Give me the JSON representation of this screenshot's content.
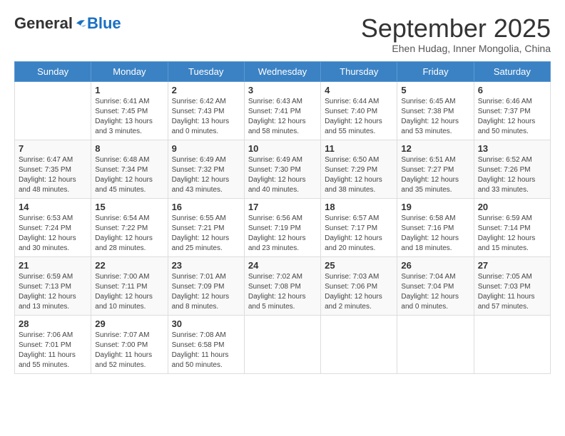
{
  "logo": {
    "general": "General",
    "blue": "Blue"
  },
  "title": {
    "month": "September 2025",
    "location": "Ehen Hudag, Inner Mongolia, China"
  },
  "headers": [
    "Sunday",
    "Monday",
    "Tuesday",
    "Wednesday",
    "Thursday",
    "Friday",
    "Saturday"
  ],
  "weeks": [
    [
      {
        "day": null,
        "sunrise": null,
        "sunset": null,
        "daylight": null
      },
      {
        "day": "1",
        "sunrise": "Sunrise: 6:41 AM",
        "sunset": "Sunset: 7:45 PM",
        "daylight": "Daylight: 13 hours and 3 minutes."
      },
      {
        "day": "2",
        "sunrise": "Sunrise: 6:42 AM",
        "sunset": "Sunset: 7:43 PM",
        "daylight": "Daylight: 13 hours and 0 minutes."
      },
      {
        "day": "3",
        "sunrise": "Sunrise: 6:43 AM",
        "sunset": "Sunset: 7:41 PM",
        "daylight": "Daylight: 12 hours and 58 minutes."
      },
      {
        "day": "4",
        "sunrise": "Sunrise: 6:44 AM",
        "sunset": "Sunset: 7:40 PM",
        "daylight": "Daylight: 12 hours and 55 minutes."
      },
      {
        "day": "5",
        "sunrise": "Sunrise: 6:45 AM",
        "sunset": "Sunset: 7:38 PM",
        "daylight": "Daylight: 12 hours and 53 minutes."
      },
      {
        "day": "6",
        "sunrise": "Sunrise: 6:46 AM",
        "sunset": "Sunset: 7:37 PM",
        "daylight": "Daylight: 12 hours and 50 minutes."
      }
    ],
    [
      {
        "day": "7",
        "sunrise": "Sunrise: 6:47 AM",
        "sunset": "Sunset: 7:35 PM",
        "daylight": "Daylight: 12 hours and 48 minutes."
      },
      {
        "day": "8",
        "sunrise": "Sunrise: 6:48 AM",
        "sunset": "Sunset: 7:34 PM",
        "daylight": "Daylight: 12 hours and 45 minutes."
      },
      {
        "day": "9",
        "sunrise": "Sunrise: 6:49 AM",
        "sunset": "Sunset: 7:32 PM",
        "daylight": "Daylight: 12 hours and 43 minutes."
      },
      {
        "day": "10",
        "sunrise": "Sunrise: 6:49 AM",
        "sunset": "Sunset: 7:30 PM",
        "daylight": "Daylight: 12 hours and 40 minutes."
      },
      {
        "day": "11",
        "sunrise": "Sunrise: 6:50 AM",
        "sunset": "Sunset: 7:29 PM",
        "daylight": "Daylight: 12 hours and 38 minutes."
      },
      {
        "day": "12",
        "sunrise": "Sunrise: 6:51 AM",
        "sunset": "Sunset: 7:27 PM",
        "daylight": "Daylight: 12 hours and 35 minutes."
      },
      {
        "day": "13",
        "sunrise": "Sunrise: 6:52 AM",
        "sunset": "Sunset: 7:26 PM",
        "daylight": "Daylight: 12 hours and 33 minutes."
      }
    ],
    [
      {
        "day": "14",
        "sunrise": "Sunrise: 6:53 AM",
        "sunset": "Sunset: 7:24 PM",
        "daylight": "Daylight: 12 hours and 30 minutes."
      },
      {
        "day": "15",
        "sunrise": "Sunrise: 6:54 AM",
        "sunset": "Sunset: 7:22 PM",
        "daylight": "Daylight: 12 hours and 28 minutes."
      },
      {
        "day": "16",
        "sunrise": "Sunrise: 6:55 AM",
        "sunset": "Sunset: 7:21 PM",
        "daylight": "Daylight: 12 hours and 25 minutes."
      },
      {
        "day": "17",
        "sunrise": "Sunrise: 6:56 AM",
        "sunset": "Sunset: 7:19 PM",
        "daylight": "Daylight: 12 hours and 23 minutes."
      },
      {
        "day": "18",
        "sunrise": "Sunrise: 6:57 AM",
        "sunset": "Sunset: 7:17 PM",
        "daylight": "Daylight: 12 hours and 20 minutes."
      },
      {
        "day": "19",
        "sunrise": "Sunrise: 6:58 AM",
        "sunset": "Sunset: 7:16 PM",
        "daylight": "Daylight: 12 hours and 18 minutes."
      },
      {
        "day": "20",
        "sunrise": "Sunrise: 6:59 AM",
        "sunset": "Sunset: 7:14 PM",
        "daylight": "Daylight: 12 hours and 15 minutes."
      }
    ],
    [
      {
        "day": "21",
        "sunrise": "Sunrise: 6:59 AM",
        "sunset": "Sunset: 7:13 PM",
        "daylight": "Daylight: 12 hours and 13 minutes."
      },
      {
        "day": "22",
        "sunrise": "Sunrise: 7:00 AM",
        "sunset": "Sunset: 7:11 PM",
        "daylight": "Daylight: 12 hours and 10 minutes."
      },
      {
        "day": "23",
        "sunrise": "Sunrise: 7:01 AM",
        "sunset": "Sunset: 7:09 PM",
        "daylight": "Daylight: 12 hours and 8 minutes."
      },
      {
        "day": "24",
        "sunrise": "Sunrise: 7:02 AM",
        "sunset": "Sunset: 7:08 PM",
        "daylight": "Daylight: 12 hours and 5 minutes."
      },
      {
        "day": "25",
        "sunrise": "Sunrise: 7:03 AM",
        "sunset": "Sunset: 7:06 PM",
        "daylight": "Daylight: 12 hours and 2 minutes."
      },
      {
        "day": "26",
        "sunrise": "Sunrise: 7:04 AM",
        "sunset": "Sunset: 7:04 PM",
        "daylight": "Daylight: 12 hours and 0 minutes."
      },
      {
        "day": "27",
        "sunrise": "Sunrise: 7:05 AM",
        "sunset": "Sunset: 7:03 PM",
        "daylight": "Daylight: 11 hours and 57 minutes."
      }
    ],
    [
      {
        "day": "28",
        "sunrise": "Sunrise: 7:06 AM",
        "sunset": "Sunset: 7:01 PM",
        "daylight": "Daylight: 11 hours and 55 minutes."
      },
      {
        "day": "29",
        "sunrise": "Sunrise: 7:07 AM",
        "sunset": "Sunset: 7:00 PM",
        "daylight": "Daylight: 11 hours and 52 minutes."
      },
      {
        "day": "30",
        "sunrise": "Sunrise: 7:08 AM",
        "sunset": "Sunset: 6:58 PM",
        "daylight": "Daylight: 11 hours and 50 minutes."
      },
      {
        "day": null,
        "sunrise": null,
        "sunset": null,
        "daylight": null
      },
      {
        "day": null,
        "sunrise": null,
        "sunset": null,
        "daylight": null
      },
      {
        "day": null,
        "sunrise": null,
        "sunset": null,
        "daylight": null
      },
      {
        "day": null,
        "sunrise": null,
        "sunset": null,
        "daylight": null
      }
    ]
  ]
}
